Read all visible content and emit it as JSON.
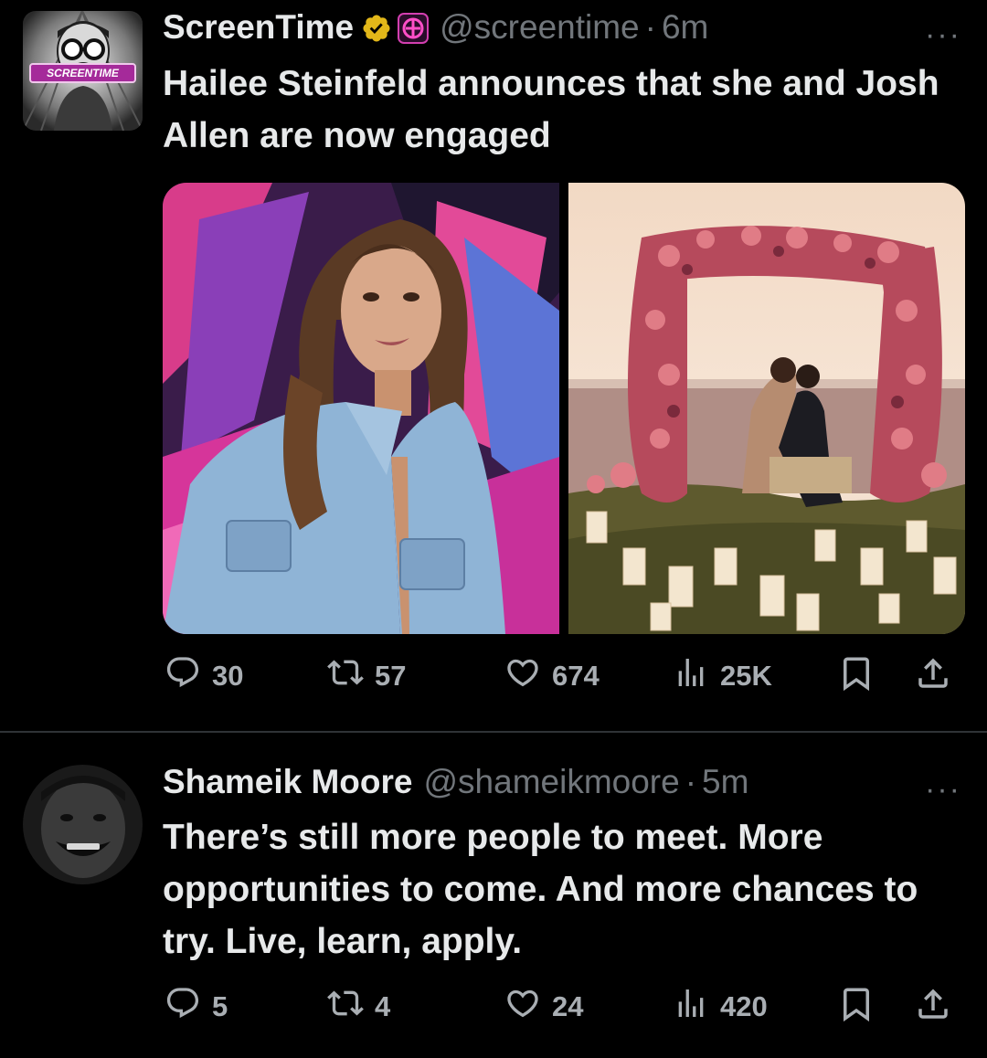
{
  "tweets": [
    {
      "author": {
        "name": "ScreenTime",
        "handle": "@screentime",
        "avatar_label": "SCREENTIME",
        "verified": true,
        "affiliate_badge": true
      },
      "dot": "·",
      "time": "6m",
      "more": "···",
      "text": "Hailee Steinfeld announces that she and Josh Allen are now engaged",
      "media": [
        "Hailee Steinfeld portrait",
        "proposal under floral arch by the sea"
      ],
      "stats": {
        "replies": "30",
        "reposts": "57",
        "likes": "674",
        "views": "25K"
      }
    },
    {
      "author": {
        "name": "Shameik Moore",
        "handle": "@shameikmoore"
      },
      "dot": "·",
      "time": "5m",
      "more": "···",
      "text": "There’s still more people to meet. More opportunities to come. And more chances to try. Live, learn, apply.",
      "stats": {
        "replies": "5",
        "reposts": "4",
        "likes": "24",
        "views": "420"
      }
    }
  ],
  "icons": [
    "reply-icon",
    "repost-icon",
    "like-icon",
    "views-icon",
    "bookmark-icon",
    "share-icon",
    "verified-badge-icon",
    "affiliate-badge-icon",
    "more-icon"
  ],
  "colors": {
    "background": "#000000",
    "text": "#e7e9ea",
    "muted": "#71767b",
    "verified": "#e2b719",
    "divider": "#2f3336"
  }
}
